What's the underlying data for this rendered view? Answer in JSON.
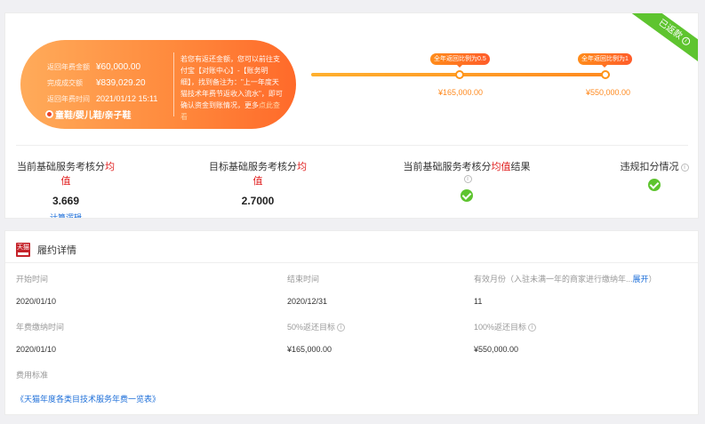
{
  "summary": {
    "badge": "已返款",
    "badge_icon": "info-icon",
    "rows": [
      {
        "label": "返回年费金额",
        "value": "¥60,000.00"
      },
      {
        "label": "完成成交额",
        "value": "¥839,029.20"
      },
      {
        "label": "返回年费时间",
        "value": "2021/01/12 15:11"
      }
    ],
    "category": "童鞋/婴儿鞋/亲子鞋",
    "note_text": "若您有返还金额，您可以前往支付宝【对账中心】-【账务明细】，找到备注为：\"上一年度天猫技术年费节返收入流水\"，即可确认资金到账情况，更多",
    "note_link": "点此查看",
    "progress": {
      "milestones": [
        {
          "tag": "全年返回比例为0.5",
          "amount": "¥165,000.00"
        },
        {
          "tag": "全年返回比例为1",
          "amount": "¥550,000.00"
        }
      ]
    }
  },
  "metrics": [
    {
      "label_prefix": "当前基础服务考核分",
      "label_red": "均值",
      "label_suffix": "",
      "value": "3.669",
      "link": "计算逻辑"
    },
    {
      "label_prefix": "目标基础服务考核分",
      "label_red": "均值",
      "label_suffix": "",
      "value": "2.7000"
    },
    {
      "label_prefix": "当前基础服务考核分",
      "label_red": "均值",
      "label_suffix": "结果",
      "status": "check-icon"
    },
    {
      "label_prefix": "违规扣分情况",
      "label_red": "",
      "label_suffix": "",
      "status": "check-icon"
    }
  ],
  "details": {
    "logo_text": "天猫",
    "title": "履约详情",
    "fields": [
      {
        "label": "开始时间",
        "value": "2020/01/10"
      },
      {
        "label": "结束时间",
        "value": "2020/12/31"
      },
      {
        "label": "有效月份（入驻未满一年的商家进行缴纳年...",
        "label_link": "展开",
        "label_end": "）",
        "value": "11"
      },
      {
        "label": "年费缴纳时间",
        "value": "2020/01/10"
      },
      {
        "label": "50%返还目标",
        "value": "¥165,000.00"
      },
      {
        "label": "100%返还目标",
        "value": "¥550,000.00"
      }
    ],
    "fee_label": "费用标准",
    "fee_link": "《天猫年度各类目技术服务年费一览表》"
  }
}
